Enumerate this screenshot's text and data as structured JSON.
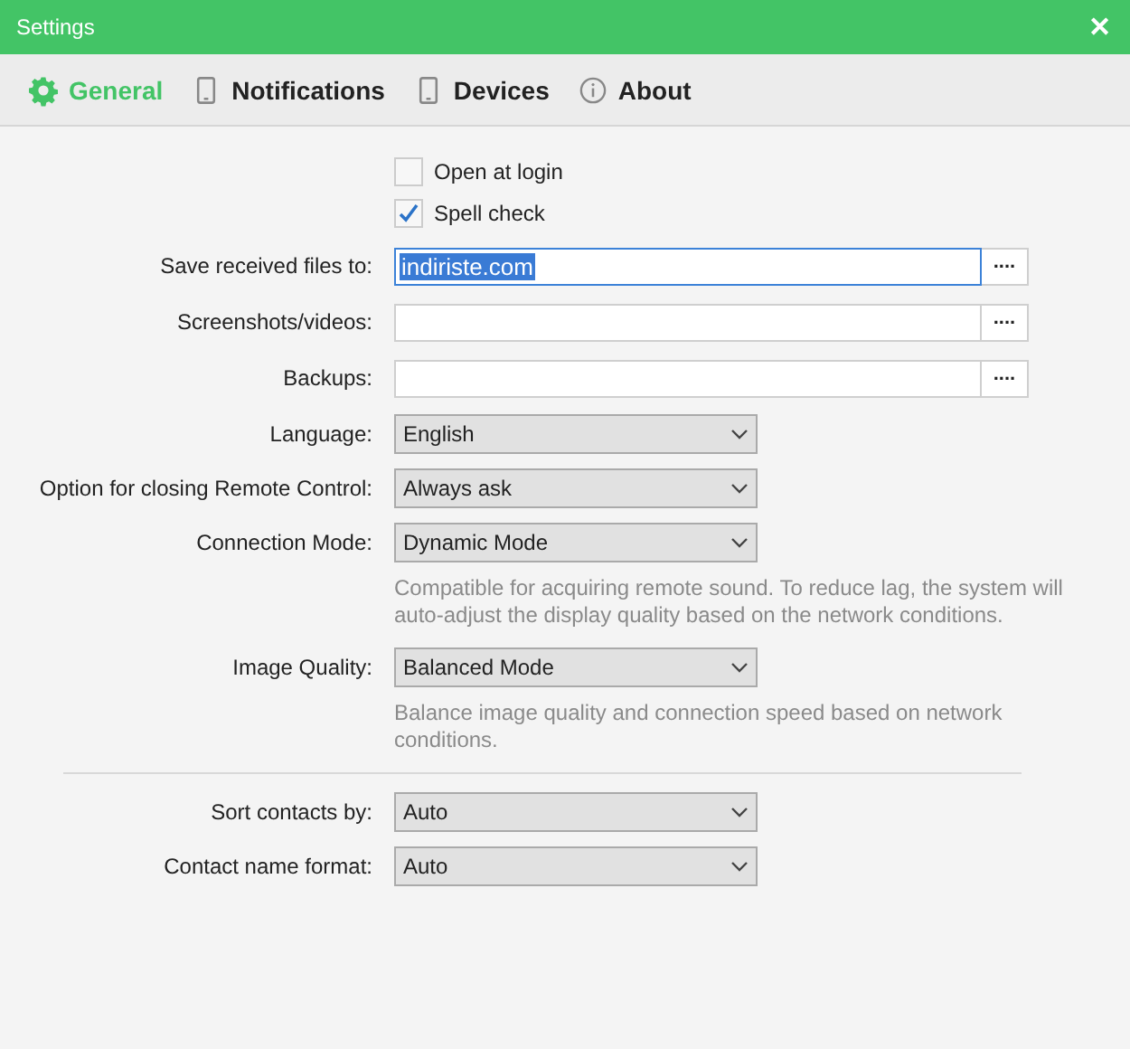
{
  "window": {
    "title": "Settings",
    "close": "✕"
  },
  "tabs": [
    {
      "label": "General",
      "kind": "gear",
      "selected": true
    },
    {
      "label": "Notifications",
      "kind": "phone",
      "selected": false
    },
    {
      "label": "Devices",
      "kind": "phone",
      "selected": false
    },
    {
      "label": "About",
      "kind": "info",
      "selected": false
    }
  ],
  "checkboxes": [
    {
      "label": "Open at login",
      "checked": false
    },
    {
      "label": "Spell check",
      "checked": true
    }
  ],
  "groups": [
    [
      {
        "kind": "path",
        "label": "Save received files to:",
        "value": "indiriste.com",
        "focused": true,
        "button": "...."
      },
      {
        "kind": "path",
        "label": "Screenshots/videos:",
        "focused": false,
        "button": "...."
      },
      {
        "kind": "path",
        "label": "Backups:",
        "focused": false,
        "button": "...."
      },
      {
        "kind": "select",
        "label": "Language:",
        "value": "English"
      },
      {
        "kind": "select",
        "label": "Option for closing Remote Control:",
        "value": "Always ask"
      },
      {
        "kind": "select",
        "label": "Connection Mode:",
        "value": "Dynamic Mode",
        "note": "Compatible for acquiring remote sound. To reduce lag, the system will auto-adjust the display quality based on the network conditions."
      },
      {
        "kind": "select",
        "label": "Image Quality:",
        "value": "Balanced Mode",
        "note": "Balance image quality and connection speed based on network conditions."
      }
    ],
    [
      {
        "kind": "select",
        "label": "Sort contacts by:",
        "value": "Auto"
      },
      {
        "kind": "select",
        "label": "Contact name format:",
        "value": "Auto"
      }
    ]
  ]
}
